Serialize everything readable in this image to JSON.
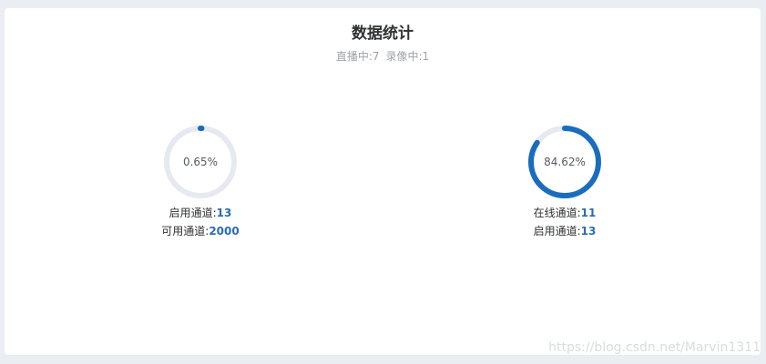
{
  "header": {
    "title": "数据统计",
    "live_label": "直播中:7",
    "record_label": "录像中:1"
  },
  "stats": [
    {
      "percent_label": "0.65%",
      "fraction": 0.0065,
      "line1_label": "启用通道:",
      "line1_value": "13",
      "line2_label": "可用通道:",
      "line2_value": "2000"
    },
    {
      "percent_label": "84.62%",
      "fraction": 0.8462,
      "line1_label": "在线通道:",
      "line1_value": "11",
      "line2_label": "启用通道:",
      "line2_value": "13"
    }
  ],
  "colors": {
    "progress": "#1a6dbd",
    "track": "#e6e9f0",
    "value_text": "#2b6cb0"
  },
  "watermark": "https://blog.csdn.net/Marvin1311"
}
